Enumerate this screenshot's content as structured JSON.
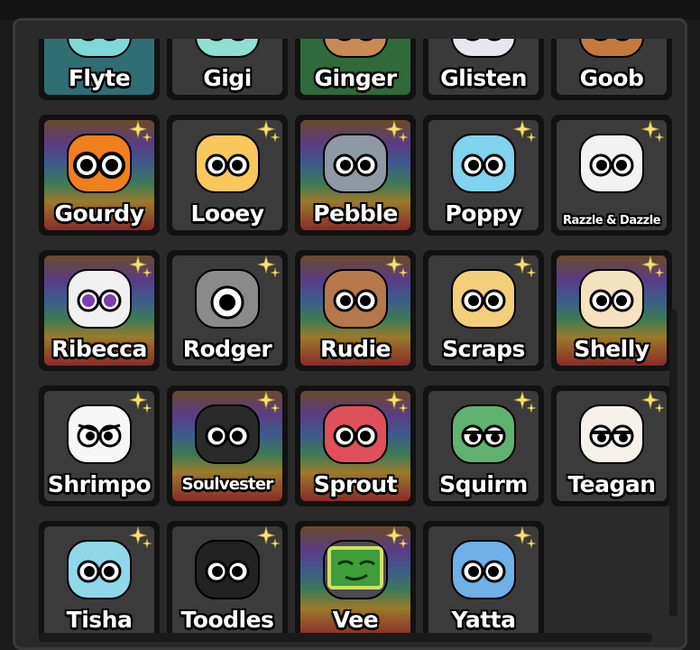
{
  "window": {
    "title": ""
  },
  "characters": [
    {
      "name": "Flyte",
      "bg": "#2f6f73",
      "skin": "#7fd8d8",
      "eyes": "round"
    },
    {
      "name": "Gigi",
      "bg": "#3a3a3a",
      "skin": "#8fe0d0",
      "eyes": "round"
    },
    {
      "name": "Ginger",
      "bg": "#2f6b3a",
      "skin": "#c98a55",
      "eyes": "round"
    },
    {
      "name": "Glisten",
      "bg": "#3a3a3a",
      "skin": "#e7e7f0",
      "eyes": "round"
    },
    {
      "name": "Goob",
      "bg": "#3a3a3a",
      "skin": "#c47a3d",
      "eyes": "round"
    },
    {
      "name": "Gourdy",
      "bg": "#3b3b3b",
      "skin": "#f07f1e",
      "eyes": "big",
      "rainbow": true
    },
    {
      "name": "Looey",
      "bg": "#3b3b3b",
      "skin": "#f8c85c",
      "eyes": "round"
    },
    {
      "name": "Pebble",
      "bg": "#3b3b3b",
      "skin": "#8d9aa3",
      "eyes": "round",
      "rainbow": true
    },
    {
      "name": "Poppy",
      "bg": "#3b3b3b",
      "skin": "#7fd3ee",
      "eyes": "round"
    },
    {
      "name": "Razzle & Dazzle",
      "bg": "#3b3b3b",
      "skin": "#f2f2f2",
      "eyes": "round",
      "tiny": true
    },
    {
      "name": "Ribecca",
      "bg": "#3b3b3b",
      "skin": "#f0f0f0",
      "eyes": "purple",
      "rainbow": true
    },
    {
      "name": "Rodger",
      "bg": "#3b3b3b",
      "skin": "#8a8a8a",
      "eyes": "one"
    },
    {
      "name": "Rudie",
      "bg": "#3b3b3b",
      "skin": "#b5784a",
      "eyes": "round",
      "rainbow": true
    },
    {
      "name": "Scraps",
      "bg": "#3b3b3b",
      "skin": "#f3cf7a",
      "eyes": "round"
    },
    {
      "name": "Shelly",
      "bg": "#3b3b3b",
      "skin": "#f5e2bf",
      "eyes": "round",
      "rainbow": true
    },
    {
      "name": "Shrimpo",
      "bg": "#3b3b3b",
      "skin": "#f7f7f7",
      "eyes": "angry"
    },
    {
      "name": "Soulvester",
      "bg": "#3b3b3b",
      "skin": "#2a2a2a",
      "eyes": "round",
      "rainbow": true,
      "small": true
    },
    {
      "name": "Sprout",
      "bg": "#3b3b3b",
      "skin": "#e0505a",
      "eyes": "round",
      "rainbow": true
    },
    {
      "name": "Squirm",
      "bg": "#3b3b3b",
      "skin": "#5fb36f",
      "eyes": "sleepy"
    },
    {
      "name": "Teagan",
      "bg": "#3b3b3b",
      "skin": "#f6f1ea",
      "eyes": "sleepy"
    },
    {
      "name": "Tisha",
      "bg": "#3b3b3b",
      "skin": "#8fd8ea",
      "eyes": "round"
    },
    {
      "name": "Toodles",
      "bg": "#3b3b3b",
      "skin": "#222222",
      "eyes": "round"
    },
    {
      "name": "Vee",
      "bg": "#3b3b3b",
      "skin": "#4c4c4c",
      "eyes": "screen",
      "rainbow": true
    },
    {
      "name": "Yatta",
      "bg": "#3b3b3b",
      "skin": "#6fb0e8",
      "eyes": "round"
    }
  ],
  "colors": {
    "panel": "#2a2a2a",
    "slot": "#111111",
    "sparkle": "#f7e27a"
  }
}
